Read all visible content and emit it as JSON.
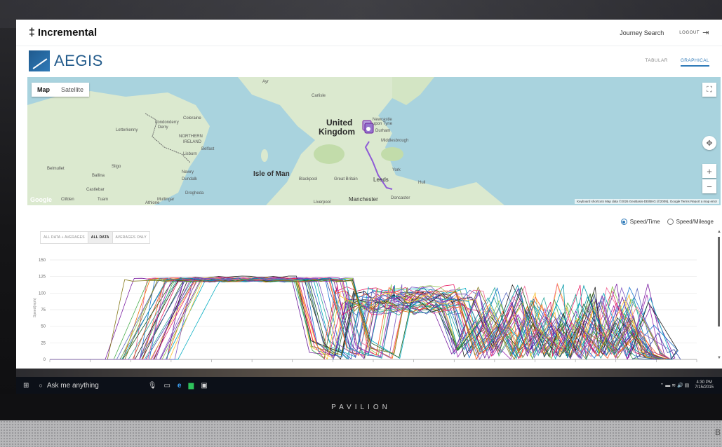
{
  "device": {
    "brand": "PAVILION"
  },
  "app": {
    "logo_text": "Incremental",
    "nav": {
      "journey_search": "Journey Search",
      "logout": "LOGOUT"
    },
    "product": "AEGIS",
    "view_tabs": [
      {
        "label": "TABULAR",
        "active": false
      },
      {
        "label": "GRAPHICAL",
        "active": true
      }
    ]
  },
  "map": {
    "type_toggle": [
      {
        "label": "Map",
        "selected": true
      },
      {
        "label": "Satellite",
        "selected": false
      }
    ],
    "labels": {
      "united": "United",
      "kingdom": "Kingdom",
      "northern": "NORTHERN",
      "ireland": "IRELAND",
      "isle_of_man": "Isle of Man",
      "londonderry": "Londonderry",
      "derry": "Derry",
      "coleraine": "Coleraine",
      "letterkenny": "Letterkenny",
      "belfast": "Belfast",
      "lisburn": "Lisburn",
      "sligo": "Sligo",
      "ballina": "Ballina",
      "castlebar": "Castlebar",
      "newry": "Newry",
      "dundalk": "Dundalk",
      "drogheda": "Drogheda",
      "mullingar": "Mullingar",
      "athlone": "Athlone",
      "tuam": "Tuam",
      "clifden": "Clifden",
      "belmullet": "Belmullet",
      "newcastle": "Newcastle",
      "upon_tyne": "upon Tyne",
      "durham": "Durham",
      "middlesbrough": "Middlesbrough",
      "york": "York",
      "leeds": "Leeds",
      "hull": "Hull",
      "blackpool": "Blackpool",
      "great_britain": "Great Britain",
      "manchester": "Manchester",
      "liverpool": "Liverpool",
      "doncaster": "Doncaster",
      "ayr": "Ayr",
      "carlisle": "Carlisle"
    },
    "google": "Google",
    "footer": "Keyboard shortcuts   Map data ©2026 GeoBasis-DE/BKG (©2009), Google   Terms   Report a map error"
  },
  "chart_controls": {
    "radios": [
      {
        "label": "Speed/Time",
        "checked": true
      },
      {
        "label": "Speed/Mileage",
        "checked": false
      }
    ],
    "filters": [
      {
        "label": "ALL DATA + AVERAGES",
        "selected": false
      },
      {
        "label": "ALL DATA",
        "selected": true
      },
      {
        "label": "AVERAGES ONLY",
        "selected": false
      }
    ]
  },
  "chart_data": {
    "type": "line",
    "ylabel": "Speed(mph)",
    "ylim": [
      0,
      150
    ],
    "yticks": [
      0,
      25,
      50,
      75,
      100,
      125,
      150
    ],
    "series_count": 40,
    "palette": [
      "#4caf50",
      "#7b1fa2",
      "#1976d2",
      "#ef6c00",
      "#26a69a",
      "#e91e63",
      "#3949ab",
      "#8bc34a",
      "#6a1b9a",
      "#00acc1",
      "#ff5722",
      "#1b5e20",
      "#9c27b0",
      "#212121",
      "#fbc02d",
      "#5c6bc0",
      "#f06292",
      "#0097a7",
      "#827717",
      "#7e57c2"
    ],
    "series_summary": [
      {
        "phase": "rise",
        "x_range": [
          10,
          22
        ],
        "plateau": 125
      },
      {
        "phase": "cruise",
        "x_range": [
          22,
          45
        ],
        "value": 125
      },
      {
        "phase": "fall",
        "x_range": [
          40,
          48
        ],
        "to": 0
      },
      {
        "phase": "mid_plateau",
        "x_range": [
          48,
          65
        ],
        "value_range": [
          85,
          118
        ]
      },
      {
        "phase": "late_oscillation",
        "x_range": [
          65,
          92
        ],
        "value_range": [
          0,
          115
        ]
      },
      {
        "phase": "tail_spike",
        "x_range": [
          92,
          98
        ],
        "peak": 40
      }
    ]
  },
  "taskbar": {
    "search": "Ask me anything",
    "time": "4:30 PM",
    "date": "7/15/2015"
  }
}
